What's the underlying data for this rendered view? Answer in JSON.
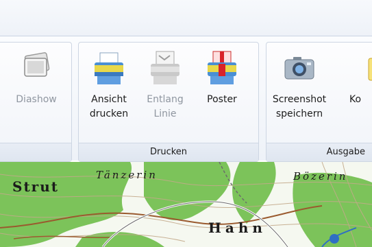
{
  "ribbon": {
    "groups": [
      {
        "label": ""
      },
      {
        "label": "Drucken"
      },
      {
        "label": "Ausgabe"
      }
    ],
    "buttons": [
      {
        "label": "Diashow",
        "icon": "slideshow-icon",
        "enabled": false
      },
      {
        "label": "Ansicht\ndrucken",
        "icon": "printer-icon",
        "enabled": true
      },
      {
        "label": "Entlang\nLinie",
        "icon": "printer-line-icon",
        "enabled": false
      },
      {
        "label": "Poster",
        "icon": "poster-printer-icon",
        "enabled": true
      },
      {
        "label": "Screenshot\nspeichern",
        "icon": "camera-icon",
        "enabled": true
      },
      {
        "label": "Ko",
        "icon": "copy-icon",
        "enabled": true
      }
    ]
  },
  "map": {
    "labels": [
      "Strut",
      "Tänzerin",
      "Bözerin",
      "Hahn"
    ]
  },
  "colors": {
    "forest_green": "#7cc35a",
    "clearing": "#f5f8f0",
    "contour": "#c3a98a",
    "road": "#9a5a2e",
    "water": "#2f6fc4"
  }
}
